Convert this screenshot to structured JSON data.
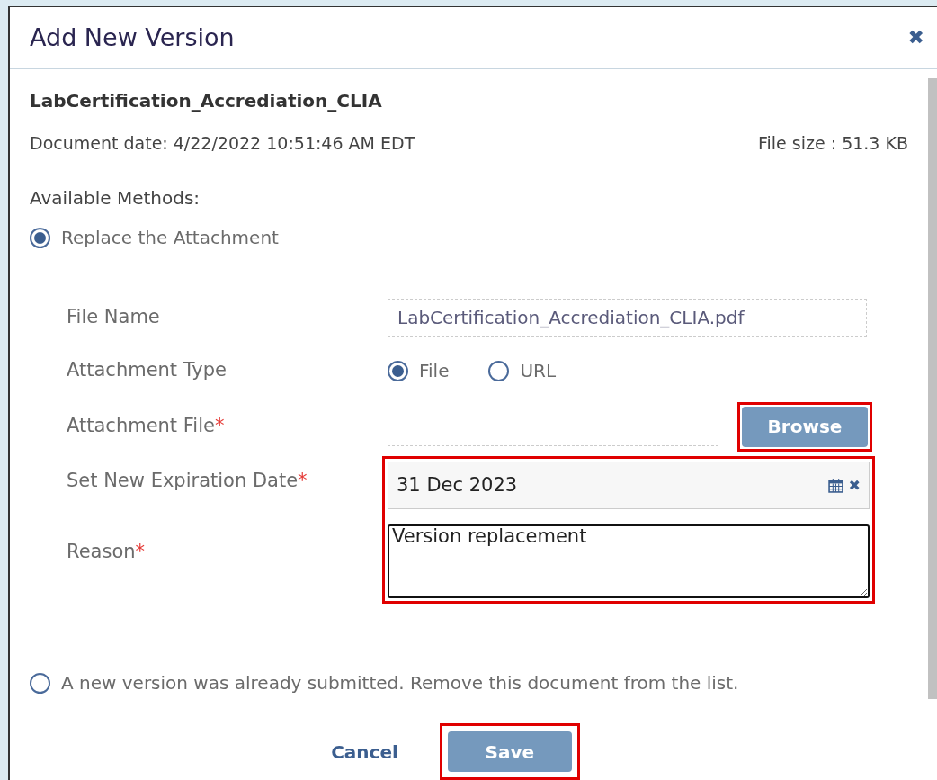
{
  "dialog": {
    "title": "Add New Version",
    "close": "✖"
  },
  "document": {
    "name": "LabCertification_Accrediation_CLIA",
    "date": "Document date: 4/22/2022 10:51:46 AM EDT",
    "size": "File size : 51.3 KB"
  },
  "methods_label": "Available Methods:",
  "methods": [
    {
      "label": "Replace the Attachment",
      "selected": true
    },
    {
      "label": "A new version was already submitted. Remove this document from the list.",
      "selected": false
    }
  ],
  "form": {
    "file_name": {
      "label": "File Name",
      "value": "LabCertification_Accrediation_CLIA.pdf"
    },
    "attachment_type": {
      "label": "Attachment Type",
      "options": [
        {
          "label": "File",
          "selected": true
        },
        {
          "label": "URL",
          "selected": false
        }
      ]
    },
    "attachment_file": {
      "label": "Attachment File",
      "mark": "*",
      "button": "Browse"
    },
    "expiration": {
      "label": "Set New Expiration Date",
      "mark": "*",
      "value": "31 Dec 2023",
      "clear": "✖"
    },
    "reason": {
      "label": "Reason",
      "mark": "*",
      "value": "Version replacement"
    }
  },
  "buttons": {
    "cancel": "Cancel",
    "save": "Save"
  }
}
